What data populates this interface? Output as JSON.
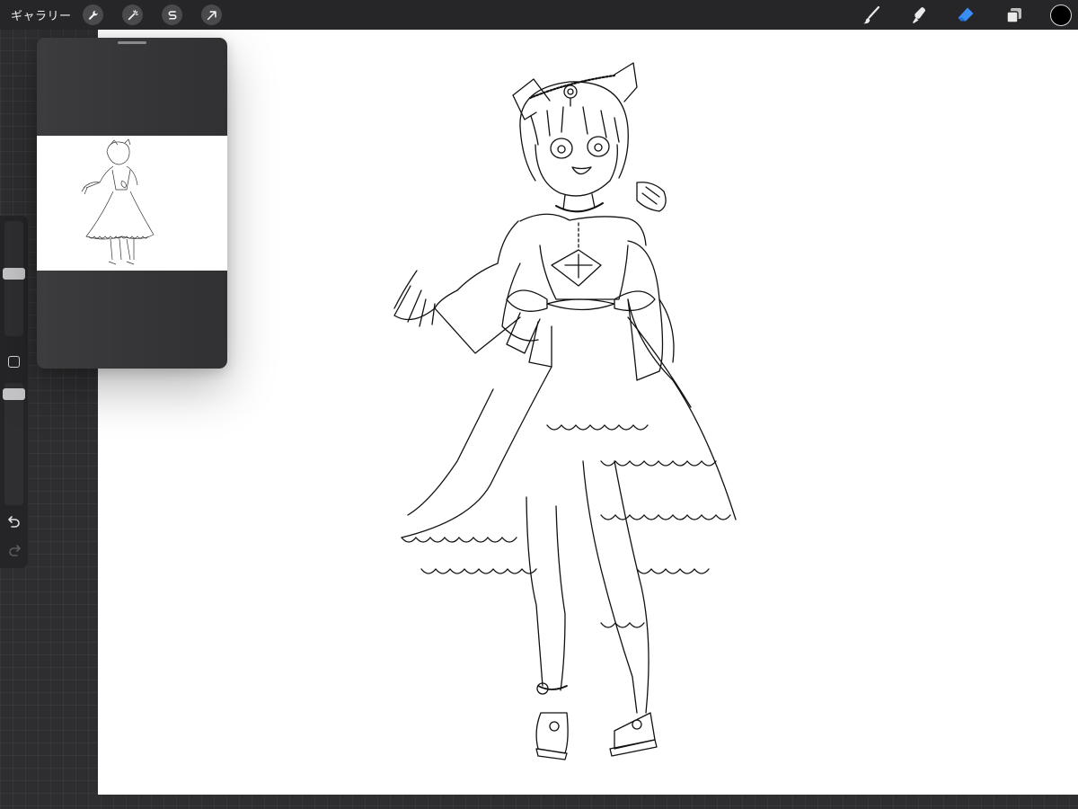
{
  "topbar": {
    "gallery_label": "ギャラリー",
    "left_tools": [
      {
        "name": "actions",
        "icon": "wrench-icon"
      },
      {
        "name": "adjustments",
        "icon": "magic-wand-icon"
      },
      {
        "name": "selection",
        "icon": "selection-s-icon"
      },
      {
        "name": "transform",
        "icon": "arrow-cursor-icon"
      }
    ],
    "right_tools": [
      {
        "name": "brush",
        "icon": "brush-icon",
        "active": false
      },
      {
        "name": "smudge",
        "icon": "smudge-icon",
        "active": false
      },
      {
        "name": "eraser",
        "icon": "eraser-icon",
        "active": true
      },
      {
        "name": "layers",
        "icon": "layers-icon",
        "active": false
      }
    ],
    "current_color": "#000000",
    "accent_color": "#3b8ef5"
  },
  "sidebar": {
    "brush_size_level": 0.55,
    "opacity_level": 0.95,
    "modify_icon": "square-icon",
    "undo_icon": "undo-icon",
    "redo_icon": "redo-icon",
    "redo_enabled": false
  },
  "reference_panel": {
    "grabber_icon": "grabber-handle"
  },
  "canvas": {
    "background": "#ffffff",
    "content": "line-art-character"
  }
}
